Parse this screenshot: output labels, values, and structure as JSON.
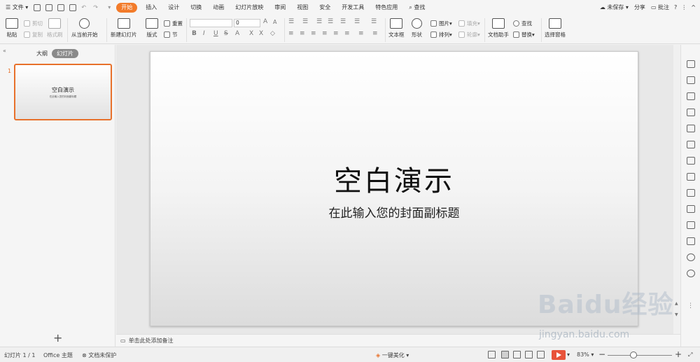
{
  "menu": {
    "file": "文件",
    "tabs": [
      "开始",
      "插入",
      "设计",
      "切换",
      "动画",
      "幻灯片放映",
      "审阅",
      "视图",
      "安全",
      "开发工具",
      "特色应用"
    ],
    "search": "查找",
    "unsaved": "未保存",
    "share": "分享",
    "comment": "批注"
  },
  "ribbon": {
    "paste": "粘贴",
    "cut": "剪切",
    "copy": "复制",
    "format_painter": "格式刷",
    "from_current": "从当前开始",
    "new_slide": "新建幻灯片",
    "layout": "版式",
    "reset": "重置",
    "section": "节",
    "font_size": "0",
    "textbox": "文本框",
    "shape": "形状",
    "picture": "图片",
    "fill": "填充",
    "arrange": "排列",
    "outline": "轮廓",
    "doc_assistant": "文档助手",
    "find": "查找",
    "replace": "替换",
    "select_pane": "选择窗格"
  },
  "left": {
    "outline_tab": "大纲",
    "slides_tab": "幻灯片",
    "slide_number": "1",
    "thumb_title": "空白演示",
    "thumb_sub": "在此输入您的封面副标题"
  },
  "slide": {
    "title": "空白演示",
    "subtitle": "在此输入您的封面副标题"
  },
  "notes": {
    "placeholder": "单击此处添加备注"
  },
  "status": {
    "slide_count": "幻灯片 1 / 1",
    "theme": "Office 主题",
    "protect": "文档未保护",
    "beautify": "一键美化",
    "zoom": "83%"
  },
  "watermark": {
    "brand": "Baidu经验",
    "url": "jingyan.baidu.com"
  }
}
